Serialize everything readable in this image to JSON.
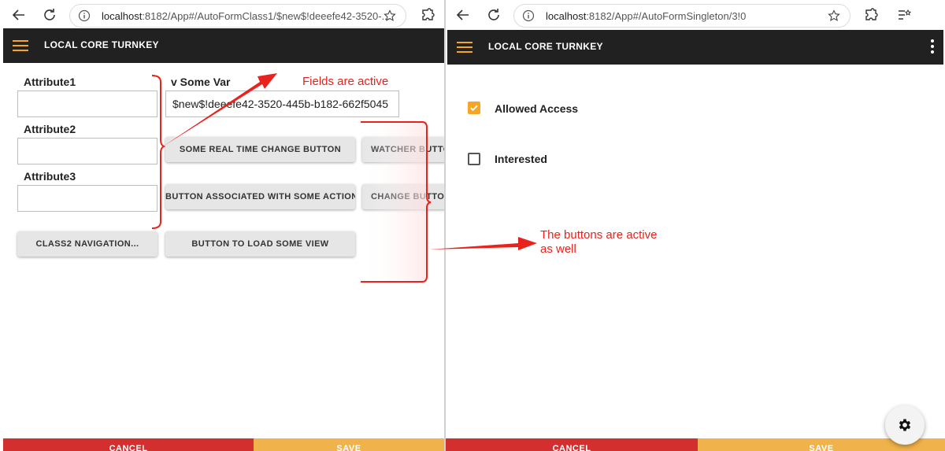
{
  "left_window": {
    "url_host": "localhost",
    "url_path": ":8182/App#/AutoFormClass1/$new$!deeefe42-3520-...",
    "app_title": "LOCAL CORE TURNKEY",
    "fields": [
      {
        "label": "Attribute1",
        "value": ""
      },
      {
        "label": "Attribute2",
        "value": ""
      },
      {
        "label": "Attribute3",
        "value": ""
      },
      {
        "label": "v Some Var",
        "value": "$new$!deeefe42-3520-445b-b182-662f5045"
      }
    ],
    "buttons": [
      "SOME REAL TIME CHANGE BUTTON",
      "WATCHER BUTTON",
      "BUTTON ASSOCIATED WITH SOME ACTION",
      "CHANGE BUTTON",
      "CLASS2 NAVIGATION...",
      "BUTTON TO LOAD SOME VIEW"
    ],
    "footer": {
      "cancel": "CANCEL",
      "save": "SAVE"
    }
  },
  "right_window": {
    "url_host": "localhost",
    "url_path": ":8182/App#/AutoFormSingleton/3!0",
    "app_title": "LOCAL CORE TURNKEY",
    "checkboxes": [
      {
        "label": "Allowed Access",
        "checked": true
      },
      {
        "label": "Interested",
        "checked": false
      }
    ],
    "footer": {
      "cancel": "CANCEL",
      "save": "SAVE"
    }
  },
  "annotations": {
    "fields": "Fields are active",
    "buttons_line1": "The buttons are active",
    "buttons_line2": "as well"
  },
  "colors": {
    "appbar": "#212121",
    "accent": "#f5a623",
    "cancel": "#d32f2f",
    "save": "#f0b24a",
    "annotation": "#e8221c"
  },
  "icons": [
    "back-arrow-icon",
    "reload-icon",
    "info-icon",
    "star-icon",
    "extensions-icon",
    "reading-list-icon",
    "menu-icon",
    "more-vert-icon",
    "gear-icon",
    "checkmark-icon"
  ]
}
